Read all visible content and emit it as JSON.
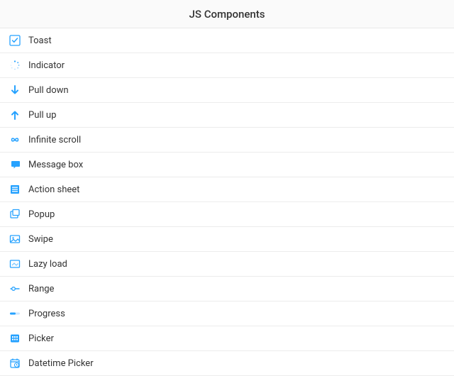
{
  "header": {
    "title": "JS Components"
  },
  "colors": {
    "accent": "#26a2ff"
  },
  "items": [
    {
      "label": "Toast",
      "icon": "check-square-icon"
    },
    {
      "label": "Indicator",
      "icon": "spinner-icon"
    },
    {
      "label": "Pull down",
      "icon": "arrow-down-icon"
    },
    {
      "label": "Pull up",
      "icon": "arrow-up-icon"
    },
    {
      "label": "Infinite scroll",
      "icon": "infinity-icon"
    },
    {
      "label": "Message box",
      "icon": "message-icon"
    },
    {
      "label": "Action sheet",
      "icon": "sheet-icon"
    },
    {
      "label": "Popup",
      "icon": "popup-icon"
    },
    {
      "label": "Swipe",
      "icon": "image-icon"
    },
    {
      "label": "Lazy load",
      "icon": "lazy-icon"
    },
    {
      "label": "Range",
      "icon": "range-icon"
    },
    {
      "label": "Progress",
      "icon": "progress-icon"
    },
    {
      "label": "Picker",
      "icon": "picker-icon"
    },
    {
      "label": "Datetime Picker",
      "icon": "datetime-icon"
    }
  ]
}
